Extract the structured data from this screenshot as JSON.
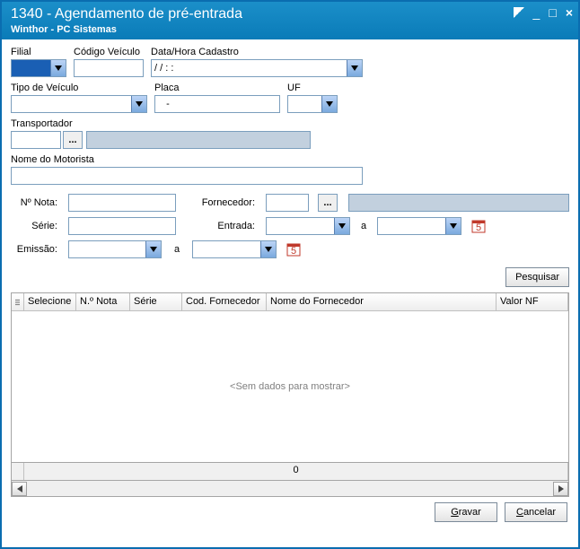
{
  "window": {
    "title": "1340 - Agendamento de pré-entrada",
    "subtitle": "Winthor - PC Sistemas"
  },
  "labels": {
    "filial": "Filial",
    "codigo_veiculo": "Código Veículo",
    "data_hora": "Data/Hora Cadastro",
    "tipo_veiculo": "Tipo de Veículo",
    "placa": "Placa",
    "uf": "UF",
    "transportador": "Transportador",
    "motorista": "Nome do Motorista",
    "n_nota": "Nº Nota:",
    "fornecedor": "Fornecedor:",
    "serie": "Série:",
    "entrada": "Entrada:",
    "emissao": "Emissão:",
    "a": "a",
    "pesquisar": "Pesquisar",
    "gravar_pre": "G",
    "gravar_rest": "ravar",
    "cancelar_pre": "C",
    "cancelar_rest": "ancelar",
    "lookup": "..."
  },
  "values": {
    "filial": "",
    "codigo_veiculo": "",
    "data_hora": "  /  /       :  :",
    "tipo_veiculo": "",
    "placa": "   -",
    "uf": "",
    "transportador": "",
    "motorista": "",
    "n_nota": "",
    "fornecedor": "",
    "serie": "",
    "entrada_de": "",
    "entrada_ate": "",
    "emissao_de": "",
    "emissao_ate": ""
  },
  "grid": {
    "columns": {
      "selecione": "Selecione",
      "n_nota": "N.º Nota",
      "serie": "Série",
      "cod_forn": "Cod. Fornecedor",
      "nome_forn": "Nome do Fornecedor",
      "valor_nf": "Valor NF"
    },
    "empty": "<Sem dados para mostrar>",
    "footer": "0"
  }
}
